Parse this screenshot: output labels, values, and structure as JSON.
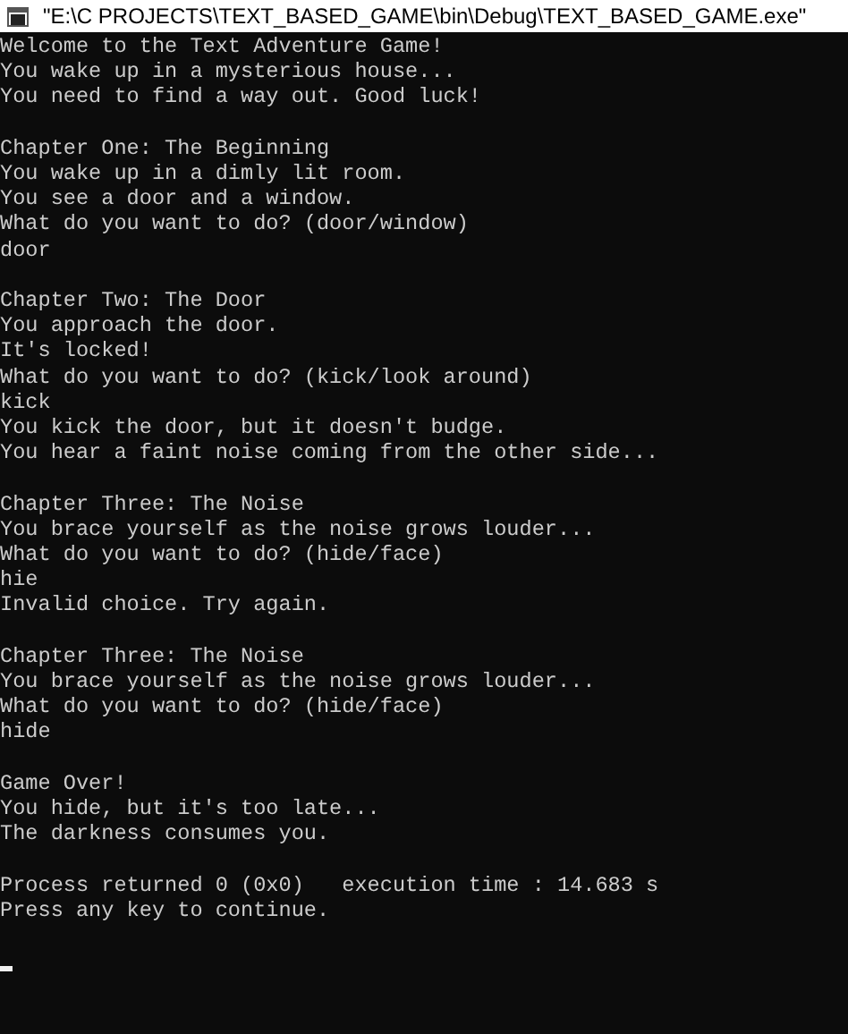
{
  "window": {
    "title": "\"E:\\C PROJECTS\\TEXT_BASED_GAME\\bin\\Debug\\TEXT_BASED_GAME.exe\""
  },
  "console": {
    "blocks": [
      [
        "Welcome to the Text Adventure Game!",
        "You wake up in a mysterious house...",
        "You need to find a way out. Good luck!"
      ],
      [
        "Chapter One: The Beginning",
        "You wake up in a dimly lit room.",
        "You see a door and a window.",
        "What do you want to do? (door/window)",
        "door"
      ],
      [
        "Chapter Two: The Door",
        "You approach the door.",
        "It's locked!",
        "What do you want to do? (kick/look around)",
        "kick",
        "You kick the door, but it doesn't budge.",
        "You hear a faint noise coming from the other side..."
      ],
      [
        "Chapter Three: The Noise",
        "You brace yourself as the noise grows louder...",
        "What do you want to do? (hide/face)",
        "hie",
        "Invalid choice. Try again."
      ],
      [
        "Chapter Three: The Noise",
        "You brace yourself as the noise grows louder...",
        "What do you want to do? (hide/face)",
        "hide"
      ],
      [
        "Game Over!",
        "You hide, but it's too late...",
        "The darkness consumes you."
      ],
      [
        "Process returned 0 (0x0)   execution time : 14.683 s",
        "Press any key to continue."
      ]
    ]
  }
}
